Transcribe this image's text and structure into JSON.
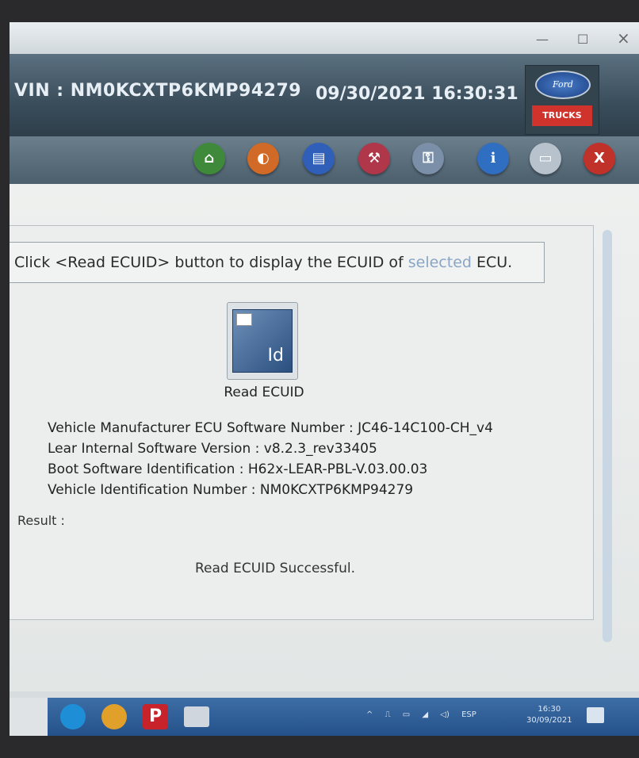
{
  "window": {
    "minimize": "—",
    "maximize": "☐",
    "close": "×"
  },
  "header": {
    "vin_text": "VIN : NM0KCXTP6KMP94279",
    "datetime": "09/30/2021 16:30:31",
    "brand": "Ford",
    "badge": "TRUCKS"
  },
  "toolbar": {
    "buttons": [
      {
        "icon": "home-icon",
        "glyph": "⌂",
        "color": "#3f8a3a"
      },
      {
        "icon": "vehicle-icon",
        "glyph": "◐",
        "color": "#d16a26"
      },
      {
        "icon": "document-icon",
        "glyph": "▤",
        "color": "#2f5fb8"
      },
      {
        "icon": "toolbox-icon",
        "glyph": "⚒",
        "color": "#b0364a"
      },
      {
        "icon": "key-icon",
        "glyph": "⚿",
        "color": "#7b8fa8"
      },
      {
        "icon": "info-icon",
        "glyph": "i",
        "color": "#2f6ec0"
      },
      {
        "icon": "window-icon",
        "glyph": "▭",
        "color": "#b7c2cc"
      },
      {
        "icon": "exit-icon",
        "glyph": "X",
        "color": "#c0312a"
      }
    ]
  },
  "main": {
    "instruction_start": "Click <Read ECUID> button to display the ECUID of ",
    "instruction_faded": "selected",
    "instruction_end": " ECU.",
    "ecuid_button_glyph": "Id",
    "ecuid_button_label": "Read ECUID",
    "info_lines": [
      "Vehicle Manufacturer ECU Software Number : JC46-14C100-CH_v4",
      "Lear Internal Software Version : v8.2.3_rev33405",
      "Boot Software Identification : H62x-LEAR-PBL-V.03.00.03",
      "Vehicle Identification Number : NM0KCXTP6KMP94279"
    ],
    "result_label": "Result :",
    "result_message": "Read ECUID Successful."
  },
  "taskbar": {
    "apps": [
      {
        "icon": "edge-icon",
        "color": "#1e8fd6"
      },
      {
        "icon": "chrome-icon",
        "color": "#e0a02a"
      },
      {
        "icon": "p-app-icon",
        "color": "#c8222a",
        "glyph": "P"
      },
      {
        "icon": "diagnostic-app-icon",
        "color": "#cfd6de"
      }
    ],
    "tray": {
      "chevron": "^",
      "lang": "ESP"
    },
    "clock_time": "16:30",
    "clock_date": "30/09/2021"
  }
}
